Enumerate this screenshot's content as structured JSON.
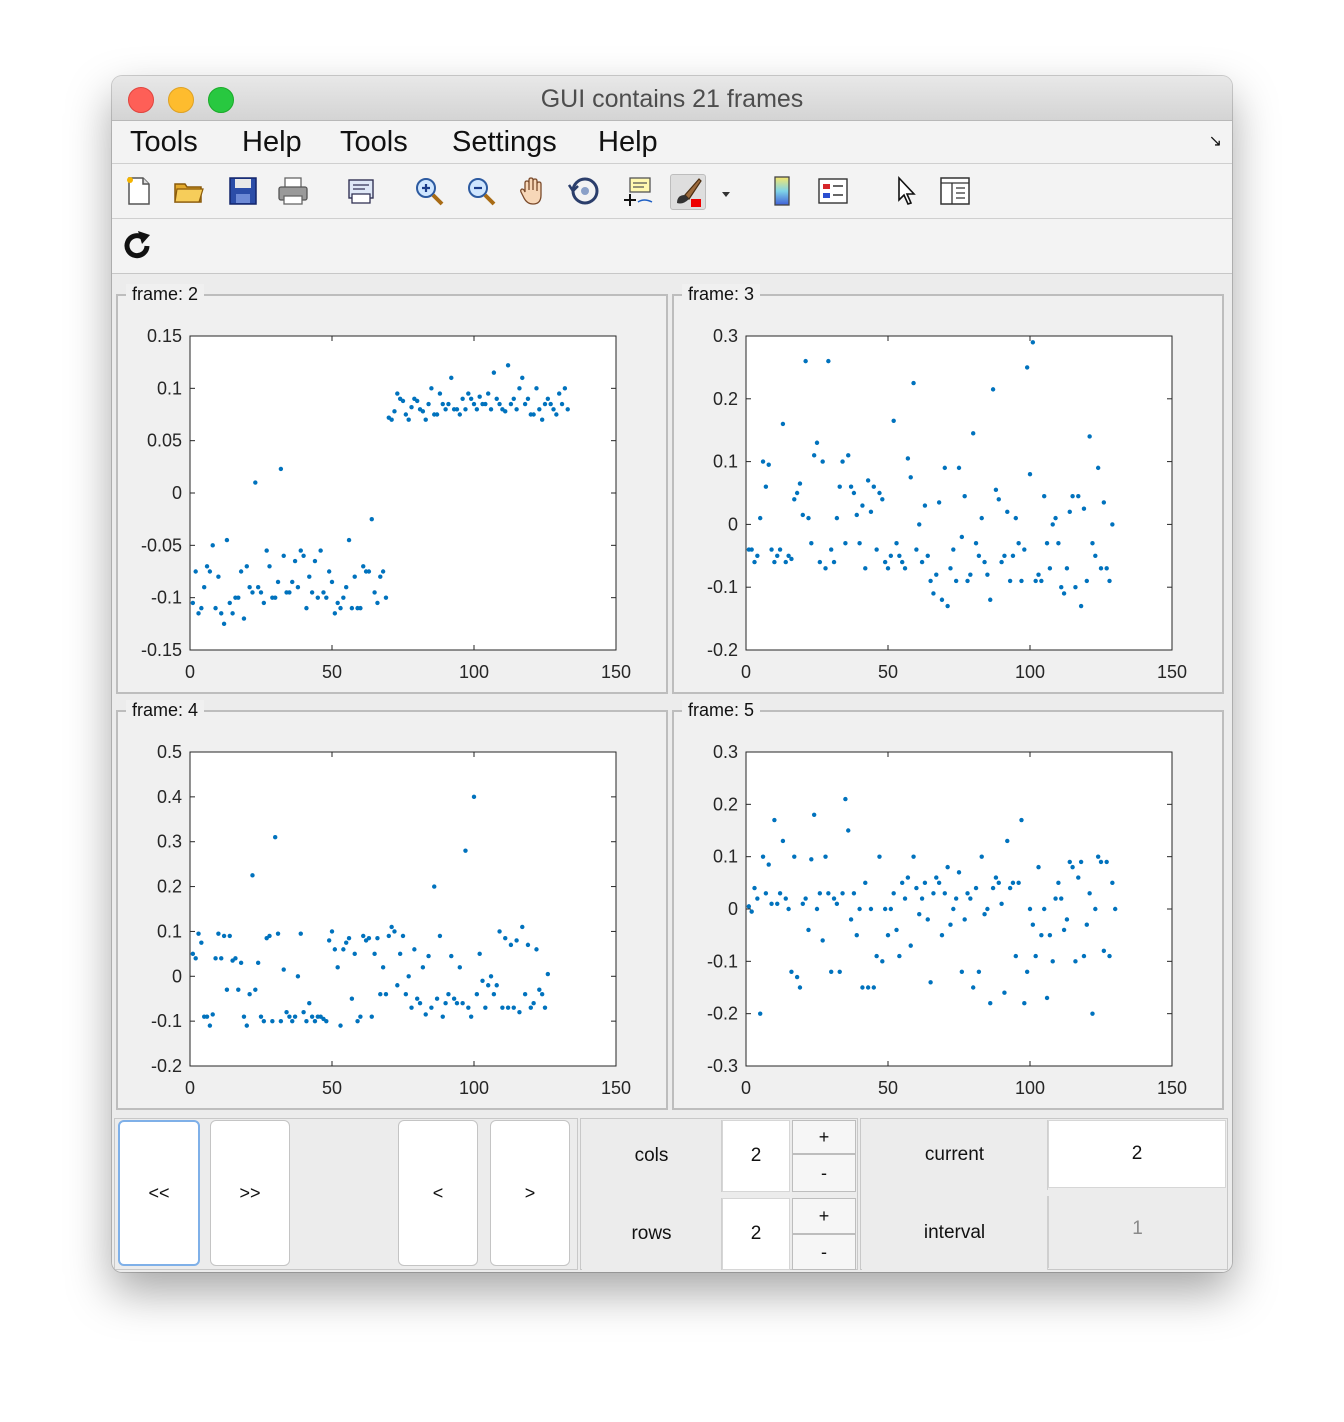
{
  "window": {
    "title": "GUI contains 21 frames"
  },
  "menu": [
    "Tools",
    "Help",
    "Tools",
    "Settings",
    "Help"
  ],
  "toolbar": {
    "icons": [
      "new-file-icon",
      "open-folder-icon",
      "save-icon",
      "print-icon",
      "print-preview-icon",
      "zoom-in-icon",
      "zoom-out-icon",
      "pan-hand-icon",
      "rotate-3d-icon",
      "data-cursor-icon",
      "brush-icon",
      "brush-dropdown-icon",
      "colorbar-icon",
      "legend-icon",
      "pointer-icon",
      "property-inspector-icon"
    ],
    "second_row_icons": [
      "refresh-icon"
    ]
  },
  "frames": [
    {
      "label": "frame: 2"
    },
    {
      "label": "frame: 3"
    },
    {
      "label": "frame: 4"
    },
    {
      "label": "frame: 5"
    }
  ],
  "controls": {
    "first_label": "<<",
    "last_label": ">>",
    "prev_label": "<",
    "next_label": ">",
    "cols_label": "cols",
    "cols_value": "2",
    "rows_label": "rows",
    "rows_value": "2",
    "plus_label": "+",
    "minus_label": "-",
    "current_label": "current",
    "current_value": "2",
    "interval_label": "interval",
    "interval_value": "1"
  },
  "colors": {
    "marker": "#0072bd",
    "axes_bg": "#ffffff",
    "panel_bg": "#f0f0f0"
  },
  "chart_data": [
    {
      "type": "scatter",
      "title": "",
      "xlabel": "",
      "ylabel": "",
      "xlim": [
        0,
        150
      ],
      "ylim": [
        -0.15,
        0.15
      ],
      "xticks": [
        "0",
        "50",
        "100",
        "150"
      ],
      "yticks": [
        "-0.15",
        "-0.1",
        "-0.05",
        "0",
        "0.05",
        "0.1",
        "0.15"
      ],
      "ytick_values": [
        -0.15,
        -0.1,
        -0.05,
        0,
        0.05,
        0.1,
        0.15
      ],
      "y": [
        -0.105,
        -0.075,
        -0.115,
        -0.11,
        -0.09,
        -0.07,
        -0.075,
        -0.05,
        -0.11,
        -0.08,
        -0.115,
        -0.125,
        -0.045,
        -0.105,
        -0.115,
        -0.1,
        -0.1,
        -0.075,
        -0.12,
        -0.07,
        -0.09,
        -0.095,
        0.01,
        -0.09,
        -0.095,
        -0.105,
        -0.055,
        -0.07,
        -0.1,
        -0.1,
        -0.085,
        0.023,
        -0.06,
        -0.095,
        -0.095,
        -0.085,
        -0.065,
        -0.09,
        -0.055,
        -0.06,
        -0.11,
        -0.08,
        -0.095,
        -0.065,
        -0.1,
        -0.055,
        -0.095,
        -0.1,
        -0.075,
        -0.085,
        -0.115,
        -0.105,
        -0.11,
        -0.1,
        -0.09,
        -0.045,
        -0.11,
        -0.08,
        -0.11,
        -0.11,
        -0.07,
        -0.075,
        -0.075,
        -0.025,
        -0.095,
        -0.105,
        -0.08,
        -0.075,
        -0.1,
        0.072,
        0.07,
        0.078,
        0.095,
        0.09,
        0.088,
        0.075,
        0.07,
        0.082,
        0.09,
        0.088,
        0.08,
        0.078,
        0.07,
        0.085,
        0.1,
        0.075,
        0.075,
        0.095,
        0.085,
        0.08,
        0.085,
        0.11,
        0.08,
        0.08,
        0.075,
        0.09,
        0.08,
        0.095,
        0.09,
        0.085,
        0.08,
        0.092,
        0.085,
        0.085,
        0.095,
        0.08,
        0.115,
        0.09,
        0.085,
        0.08,
        0.078,
        0.122,
        0.085,
        0.09,
        0.08,
        0.1,
        0.11,
        0.085,
        0.09,
        0.075,
        0.075,
        0.1,
        0.08,
        0.07,
        0.085,
        0.09,
        0.085,
        0.08,
        0.075,
        0.095,
        0.085,
        0.1,
        0.08
      ]
    },
    {
      "type": "scatter",
      "title": "",
      "xlabel": "",
      "ylabel": "",
      "xlim": [
        0,
        150
      ],
      "ylim": [
        -0.2,
        0.3
      ],
      "xticks": [
        "0",
        "50",
        "100",
        "150"
      ],
      "yticks": [
        "-0.2",
        "-0.1",
        "0",
        "0.1",
        "0.2",
        "0.3"
      ],
      "ytick_values": [
        -0.2,
        -0.1,
        0,
        0.1,
        0.2,
        0.3
      ],
      "y": [
        -0.04,
        -0.04,
        -0.06,
        -0.05,
        0.01,
        0.1,
        0.06,
        0.095,
        -0.04,
        -0.06,
        -0.05,
        -0.04,
        0.16,
        -0.06,
        -0.05,
        -0.055,
        0.04,
        0.05,
        0.065,
        0.015,
        0.26,
        0.01,
        -0.03,
        0.11,
        0.13,
        -0.06,
        0.1,
        -0.07,
        0.26,
        -0.04,
        -0.06,
        0.01,
        0.06,
        0.1,
        -0.03,
        0.11,
        0.06,
        0.05,
        0.015,
        -0.03,
        0.03,
        -0.07,
        0.07,
        0.02,
        0.06,
        -0.04,
        0.05,
        0.04,
        -0.06,
        -0.07,
        -0.05,
        0.165,
        -0.03,
        -0.05,
        -0.06,
        -0.07,
        0.105,
        0.075,
        0.225,
        -0.04,
        0.0,
        -0.06,
        0.03,
        -0.05,
        -0.09,
        -0.11,
        -0.08,
        0.035,
        -0.12,
        0.09,
        -0.13,
        -0.07,
        -0.04,
        -0.09,
        0.09,
        -0.02,
        0.045,
        -0.09,
        -0.08,
        0.145,
        -0.03,
        -0.05,
        0.01,
        -0.06,
        -0.08,
        -0.12,
        0.215,
        0.055,
        0.04,
        -0.06,
        -0.05,
        0.02,
        -0.09,
        -0.05,
        0.01,
        -0.03,
        -0.09,
        -0.04,
        0.25,
        0.08,
        0.29,
        -0.09,
        -0.08,
        -0.09,
        0.045,
        -0.03,
        -0.07,
        0.0,
        0.01,
        -0.03,
        -0.1,
        -0.11,
        -0.07,
        0.02,
        0.045,
        -0.1,
        0.045,
        -0.13,
        0.025,
        -0.09,
        0.14,
        -0.03,
        -0.05,
        0.09,
        -0.07,
        0.035,
        -0.07,
        -0.09,
        0.0
      ]
    },
    {
      "type": "scatter",
      "title": "",
      "xlabel": "",
      "ylabel": "",
      "xlim": [
        0,
        150
      ],
      "ylim": [
        -0.2,
        0.5
      ],
      "xticks": [
        "0",
        "50",
        "100",
        "150"
      ],
      "yticks": [
        "-0.2",
        "-0.1",
        "0",
        "0.1",
        "0.2",
        "0.3",
        "0.4",
        "0.5"
      ],
      "ytick_values": [
        -0.2,
        -0.1,
        0,
        0.1,
        0.2,
        0.3,
        0.4,
        0.5
      ],
      "y": [
        0.05,
        0.04,
        0.095,
        0.075,
        -0.09,
        -0.09,
        -0.11,
        -0.085,
        0.04,
        0.095,
        0.04,
        0.09,
        -0.03,
        0.09,
        0.035,
        0.04,
        -0.03,
        0.03,
        -0.09,
        -0.11,
        -0.04,
        0.225,
        -0.03,
        0.03,
        -0.09,
        -0.1,
        0.085,
        0.09,
        -0.1,
        0.31,
        0.095,
        -0.1,
        0.015,
        -0.08,
        -0.09,
        -0.1,
        -0.09,
        0.0,
        0.095,
        -0.08,
        -0.1,
        -0.06,
        -0.09,
        -0.1,
        -0.09,
        -0.09,
        -0.095,
        -0.1,
        0.08,
        0.1,
        0.06,
        0.02,
        -0.11,
        0.06,
        0.075,
        0.085,
        -0.05,
        0.05,
        -0.1,
        -0.09,
        0.09,
        0.08,
        0.085,
        -0.09,
        0.05,
        0.085,
        -0.04,
        0.02,
        -0.04,
        0.09,
        0.11,
        0.1,
        -0.02,
        0.05,
        0.09,
        -0.04,
        0.0,
        -0.07,
        0.06,
        -0.05,
        -0.06,
        0.02,
        -0.085,
        0.045,
        -0.07,
        0.2,
        -0.05,
        0.09,
        -0.09,
        -0.06,
        -0.04,
        0.045,
        -0.05,
        -0.06,
        0.02,
        -0.06,
        0.28,
        -0.07,
        -0.09,
        0.4,
        -0.04,
        0.05,
        -0.01,
        -0.07,
        -0.02,
        0.0,
        -0.04,
        -0.02,
        0.1,
        -0.07,
        0.085,
        -0.07,
        0.07,
        -0.07,
        0.08,
        -0.08,
        0.11,
        -0.04,
        0.07,
        -0.07,
        -0.06,
        0.06,
        -0.03,
        -0.04,
        -0.07,
        0.005
      ]
    },
    {
      "type": "scatter",
      "title": "",
      "xlabel": "",
      "ylabel": "",
      "xlim": [
        0,
        150
      ],
      "ylim": [
        -0.3,
        0.3
      ],
      "xticks": [
        "0",
        "50",
        "100",
        "150"
      ],
      "yticks": [
        "-0.3",
        "-0.2",
        "-0.1",
        "0",
        "0.1",
        "0.2",
        "0.3"
      ],
      "ytick_values": [
        -0.3,
        -0.2,
        -0.1,
        0,
        0.1,
        0.2,
        0.3
      ],
      "y": [
        0.005,
        -0.005,
        0.04,
        0.02,
        -0.2,
        0.1,
        0.03,
        0.085,
        0.01,
        0.17,
        0.01,
        0.03,
        0.13,
        0.02,
        0.0,
        -0.12,
        0.1,
        -0.13,
        -0.15,
        0.01,
        0.02,
        -0.04,
        0.095,
        0.18,
        0.0,
        0.03,
        -0.06,
        0.1,
        0.03,
        -0.12,
        0.02,
        0.01,
        -0.12,
        0.03,
        0.21,
        0.15,
        -0.02,
        0.03,
        -0.05,
        0.0,
        -0.15,
        0.05,
        -0.15,
        0.0,
        -0.15,
        -0.09,
        0.1,
        -0.1,
        0.0,
        -0.05,
        0.0,
        0.03,
        -0.04,
        -0.09,
        0.05,
        0.02,
        0.06,
        -0.07,
        0.1,
        0.04,
        -0.01,
        0.02,
        0.05,
        -0.02,
        -0.14,
        0.03,
        0.06,
        0.05,
        -0.05,
        0.03,
        0.08,
        -0.03,
        0.0,
        0.02,
        0.07,
        -0.12,
        -0.02,
        0.03,
        0.02,
        -0.15,
        0.04,
        -0.12,
        0.1,
        -0.01,
        0.0,
        -0.18,
        0.04,
        0.06,
        0.05,
        0.01,
        -0.16,
        0.13,
        0.04,
        0.05,
        -0.09,
        0.05,
        0.17,
        -0.18,
        -0.12,
        0.0,
        -0.03,
        -0.09,
        0.08,
        -0.05,
        0.0,
        -0.17,
        -0.05,
        -0.1,
        0.02,
        0.05,
        0.02,
        -0.04,
        -0.02,
        0.09,
        0.08,
        -0.1,
        0.06,
        0.09,
        -0.09,
        -0.03,
        0.03,
        -0.2,
        0.0,
        0.1,
        0.09,
        -0.08,
        0.09,
        -0.09,
        0.05,
        0.0
      ]
    }
  ]
}
